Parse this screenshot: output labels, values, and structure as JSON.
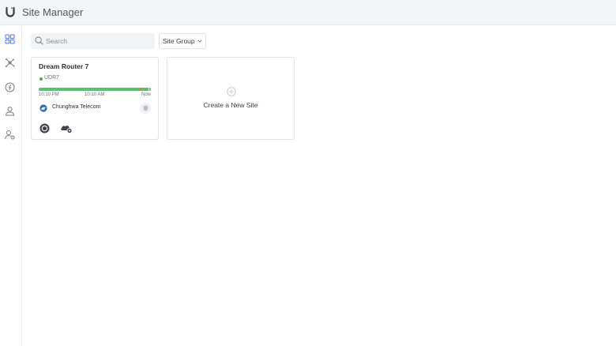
{
  "app": {
    "title": "Site Manager",
    "logo_icon": "ubiquiti-logo-icon"
  },
  "sidebar": {
    "items": [
      {
        "name": "dashboard",
        "icon": "grid-icon",
        "active": true
      },
      {
        "name": "topology",
        "icon": "network-icon",
        "active": false
      },
      {
        "name": "isp",
        "icon": "speed-icon",
        "active": false
      },
      {
        "name": "users",
        "icon": "user-icon",
        "active": false
      },
      {
        "name": "admins",
        "icon": "user-settings-icon",
        "active": false
      }
    ]
  },
  "toolbar": {
    "search_placeholder": "Search",
    "site_group_label": "Site Group"
  },
  "sites": [
    {
      "name": "Dream Router 7",
      "model": "UDR7",
      "status_color": "#3fb24f",
      "uptime_ticks": [
        "10:10 PM",
        "10:10 AM",
        "Now"
      ],
      "isp": "Chunghwa Telecom"
    }
  ],
  "new_site": {
    "label": "Create a New Site"
  },
  "colors": {
    "accent": "#4f73ff",
    "online": "#3fb24f",
    "uptime": "#5cbf6a",
    "uptime_gap": "#e07b3c"
  }
}
